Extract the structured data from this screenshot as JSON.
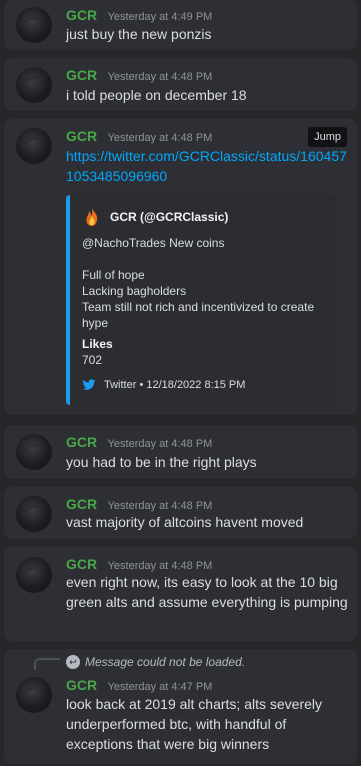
{
  "messages": [
    {
      "author": "GCR",
      "time": "Yesterday at 4:49 PM",
      "text": "just buy the new ponzis"
    },
    {
      "author": "GCR",
      "time": "Yesterday at 4:48 PM",
      "text": "i told people on december 18"
    },
    {
      "author": "GCR",
      "time": "Yesterday at 4:48 PM",
      "link": "https://twitter.com/GCRClassic/status/1604571053485096960",
      "jump_label": "Jump"
    },
    {
      "author": "GCR",
      "time": "Yesterday at 4:48 PM",
      "text": "you had to be in the right plays"
    },
    {
      "author": "GCR",
      "time": "Yesterday at 4:48 PM",
      "text": "vast majority of altcoins havent moved"
    },
    {
      "author": "GCR",
      "time": "Yesterday at 4:48 PM",
      "text": "even right now, its easy to look at the 10 big green alts and assume everything is pumping"
    },
    {
      "author": "GCR",
      "time": "Yesterday at 4:47 PM",
      "text": "look back at 2019 alt charts;  alts severely underperformed btc, with handful of exceptions that were big winners",
      "reply_text": "Message could not be loaded."
    }
  ],
  "embed": {
    "author": "GCR (@GCRClassic)",
    "mention": "@NachoTrades New coins",
    "lines": [
      "Full of hope",
      "Lacking bagholders",
      "Team still not rich and incentivized to create hype"
    ],
    "field_name": "Likes",
    "field_value": "702",
    "footer": "Twitter • 12/18/2022 8:15 PM",
    "accent_color": "#1d9bf0"
  },
  "colors": {
    "author": "#48a84a",
    "link": "#00a8fc",
    "background": "#26272b",
    "message_bg": "#2e2f34"
  }
}
